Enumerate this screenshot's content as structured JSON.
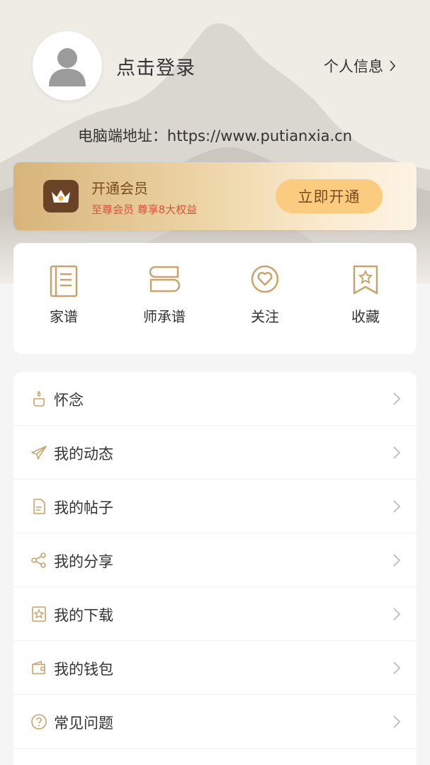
{
  "header": {
    "login_label": "点击登录",
    "profile_label": "个人信息",
    "pc_address": "电脑端地址：https://www.putianxia.cn"
  },
  "vip": {
    "title": "开通会员",
    "subtitle": "至尊会员 尊享8大权益",
    "button_label": "立即开通"
  },
  "quick_actions": [
    {
      "label": "家谱",
      "icon": "book-icon"
    },
    {
      "label": "师承谱",
      "icon": "stacked-books-icon"
    },
    {
      "label": "关注",
      "icon": "heart-circle-icon"
    },
    {
      "label": "收藏",
      "icon": "bookmark-star-icon"
    }
  ],
  "menu": [
    {
      "label": "怀念",
      "icon": "candle-icon"
    },
    {
      "label": "我的动态",
      "icon": "paper-plane-icon"
    },
    {
      "label": "我的帖子",
      "icon": "document-icon"
    },
    {
      "label": "我的分享",
      "icon": "share-icon"
    },
    {
      "label": "我的下载",
      "icon": "download-star-icon"
    },
    {
      "label": "我的钱包",
      "icon": "wallet-icon"
    },
    {
      "label": "常见问题",
      "icon": "question-circle-icon"
    }
  ],
  "colors": {
    "accent_gold": "#c9a46a",
    "vip_text": "#7a4b20",
    "vip_highlight": "#d8523a",
    "vip_button": "#fbcb7f"
  }
}
